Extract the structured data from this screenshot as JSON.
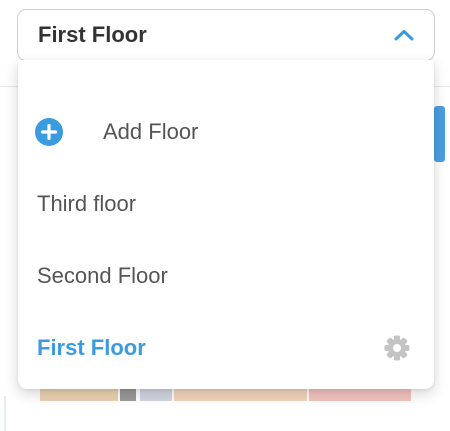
{
  "floor_select": {
    "selected": "First Floor",
    "chevron_icon": "chevron-up-icon"
  },
  "menu": {
    "add_label": "Add Floor",
    "add_icon": "plus-circle-icon",
    "items": [
      {
        "label": "Third floor"
      },
      {
        "label": "Second Floor"
      },
      {
        "label": "First Floor",
        "selected": true
      }
    ],
    "settings_icon": "gear-icon"
  },
  "colors": {
    "accent": "#3b9be0",
    "text": "#555555",
    "selected_text": "#333333",
    "icon_muted": "#c4c4c4"
  }
}
